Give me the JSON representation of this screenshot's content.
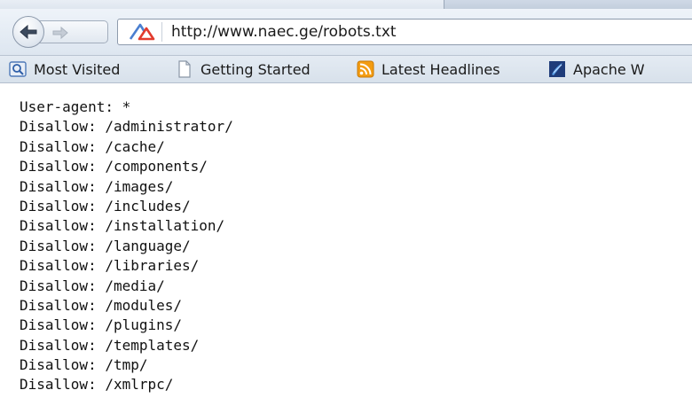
{
  "browser": {
    "url": "http://www.naec.ge/robots.txt",
    "bookmarks": [
      {
        "label": "Most Visited",
        "icon": "most-visited-icon"
      },
      {
        "label": "Getting Started",
        "icon": "page-icon"
      },
      {
        "label": "Latest Headlines",
        "icon": "rss-feed-icon"
      },
      {
        "label": "Apache W",
        "icon": "apache-feather-icon"
      }
    ]
  },
  "robots": {
    "lines": [
      "User-agent: *",
      "Disallow: /administrator/",
      "Disallow: /cache/",
      "Disallow: /components/",
      "Disallow: /images/",
      "Disallow: /includes/",
      "Disallow: /installation/",
      "Disallow: /language/",
      "Disallow: /libraries/",
      "Disallow: /media/",
      "Disallow: /modules/",
      "Disallow: /plugins/",
      "Disallow: /templates/",
      "Disallow: /tmp/",
      "Disallow: /xmlrpc/"
    ]
  },
  "colors": {
    "toolbar": "#dde6f0",
    "bookmarks_bar": "#d8e1eb",
    "page_background": "#ffffff",
    "text": "#111111",
    "rss_orange": "#f39c12"
  }
}
